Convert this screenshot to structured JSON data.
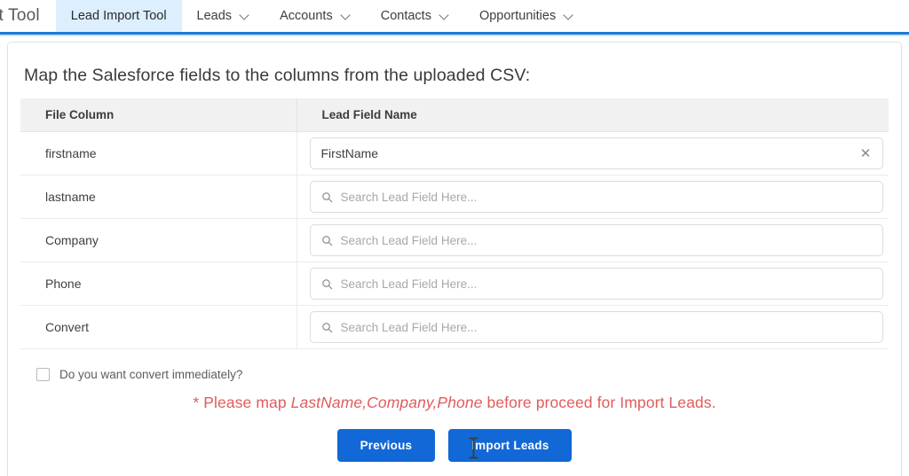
{
  "navbar": {
    "app_name": "rt Tool",
    "items": [
      {
        "label": "Lead Import Tool",
        "has_chevron": false,
        "active": true
      },
      {
        "label": "Leads",
        "has_chevron": true,
        "active": false
      },
      {
        "label": "Accounts",
        "has_chevron": true,
        "active": false
      },
      {
        "label": "Contacts",
        "has_chevron": true,
        "active": false
      },
      {
        "label": "Opportunities",
        "has_chevron": true,
        "active": false
      }
    ],
    "accent_color": "#1b7bd8",
    "active_tab_background": "#ddeeff"
  },
  "main": {
    "heading": "Map the Salesforce fields to the columns from the uploaded CSV:",
    "table": {
      "headers": {
        "file_column": "File Column",
        "lead_field_name": "Lead Field Name"
      },
      "rows": [
        {
          "file_column": "firstname",
          "field_value": "FirstName",
          "field_placeholder": "",
          "filled": true,
          "clear_icon": "close-icon"
        },
        {
          "file_column": "lastname",
          "field_value": "",
          "field_placeholder": "Search Lead Field Here...",
          "filled": false,
          "search_icon": "search-icon"
        },
        {
          "file_column": "Company",
          "field_value": "",
          "field_placeholder": "Search Lead Field Here...",
          "filled": false,
          "search_icon": "search-icon"
        },
        {
          "file_column": "Phone",
          "field_value": "",
          "field_placeholder": "Search Lead Field Here...",
          "filled": false,
          "search_icon": "search-icon"
        },
        {
          "file_column": "Convert",
          "field_value": "",
          "field_placeholder": "Search Lead Field Here...",
          "filled": false,
          "search_icon": "search-icon"
        }
      ]
    },
    "convert_checkbox": {
      "label": "Do you want convert immediately?",
      "checked": false
    },
    "warning": {
      "prefix": "* Please map ",
      "fields": "LastName,Company,Phone",
      "suffix": " before proceed for Import Leads.",
      "color": "#e05c5c"
    },
    "buttons": {
      "previous": "Previous",
      "import_leads": "Import Leads",
      "color": "#1268d6"
    }
  }
}
